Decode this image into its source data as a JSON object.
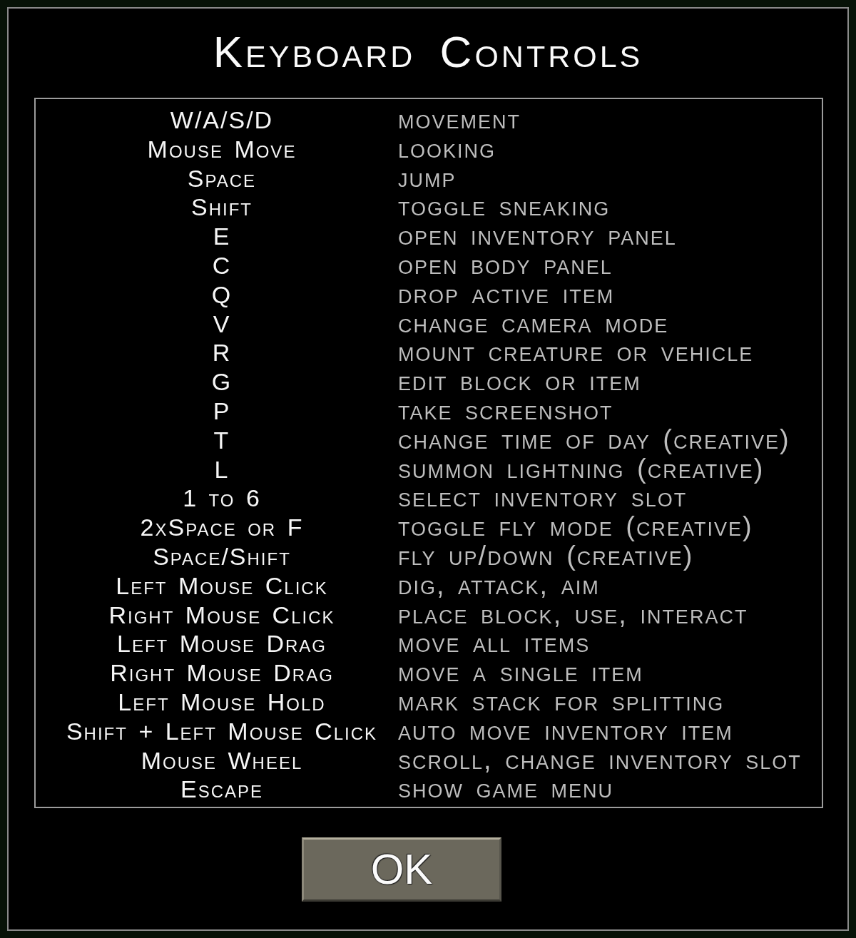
{
  "dialog": {
    "title": "Keyboard Controls",
    "bindings": [
      {
        "key": "W/A/S/D",
        "action": "movement"
      },
      {
        "key": "Mouse Move",
        "action": "looking"
      },
      {
        "key": "Space",
        "action": "jump"
      },
      {
        "key": "Shift",
        "action": "toggle sneaking"
      },
      {
        "key": "E",
        "action": "open inventory panel"
      },
      {
        "key": "C",
        "action": "open body panel"
      },
      {
        "key": "Q",
        "action": "drop active item"
      },
      {
        "key": "V",
        "action": "change camera mode"
      },
      {
        "key": "R",
        "action": "mount creature or vehicle"
      },
      {
        "key": "G",
        "action": "edit block or item"
      },
      {
        "key": "P",
        "action": "take screenshot"
      },
      {
        "key": "T",
        "action": "change time of day (creative)"
      },
      {
        "key": "L",
        "action": "summon lightning (creative)"
      },
      {
        "key": "1 to 6",
        "action": "select inventory slot"
      },
      {
        "key": "2xSpace or F",
        "action": "toggle fly mode (creative)"
      },
      {
        "key": "Space/Shift",
        "action": "fly up/down (creative)"
      },
      {
        "key": "Left Mouse Click",
        "action": "dig, attack, aim"
      },
      {
        "key": "Right Mouse Click",
        "action": "place block, use, interact"
      },
      {
        "key": "Left Mouse Drag",
        "action": "move all items"
      },
      {
        "key": "Right Mouse Drag",
        "action": "move a single item"
      },
      {
        "key": "Left Mouse Hold",
        "action": "mark stack for splitting"
      },
      {
        "key": "Shift + Left Mouse Click",
        "action": "auto move inventory item"
      },
      {
        "key": "Mouse Wheel",
        "action": "scroll, change inventory slot"
      },
      {
        "key": "Escape",
        "action": "show game menu"
      }
    ],
    "buttons": [
      "OK"
    ]
  }
}
